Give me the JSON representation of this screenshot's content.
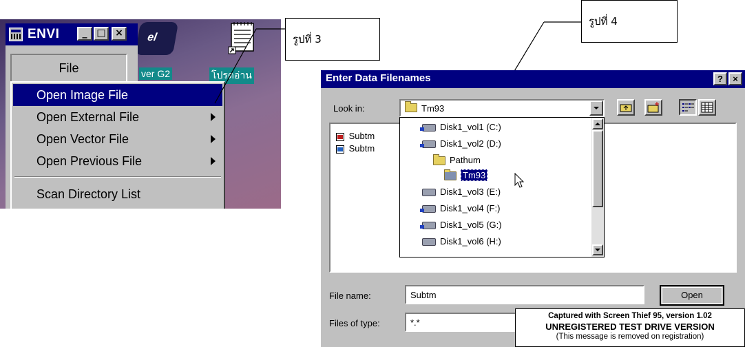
{
  "left_panel": {
    "window_title": "ENVI",
    "file_menu_label": "File",
    "menu_items": [
      {
        "label": "Open Image File",
        "selected": true,
        "submenu": false
      },
      {
        "label": "Open External File",
        "selected": false,
        "submenu": true
      },
      {
        "label": "Open Vector File",
        "selected": false,
        "submenu": true
      },
      {
        "label": "Open Previous File",
        "selected": false,
        "submenu": true
      },
      {
        "label": "Scan Directory List",
        "selected": false,
        "submenu": false
      }
    ],
    "desktop_labels": {
      "left": "ver G2",
      "right": "โปรดอ่าน",
      "logo": "el"
    },
    "callout": "รูปที่ 3"
  },
  "dialog": {
    "title": "Enter Data Filenames",
    "callout": "รูปที่ 4",
    "look_in_label": "Look in:",
    "look_in_value": "Tm93",
    "files": [
      "Subtm",
      "Subtm"
    ],
    "tree": [
      {
        "label": "Disk1_vol1 (C:)",
        "kind": "drive-net",
        "indent": 0
      },
      {
        "label": "Disk1_vol2 (D:)",
        "kind": "drive-net",
        "indent": 0
      },
      {
        "label": "Pathum",
        "kind": "folder",
        "indent": 1
      },
      {
        "label": "Tm93",
        "kind": "folder-open",
        "indent": 2,
        "selected": true
      },
      {
        "label": "Disk1_vol3 (E:)",
        "kind": "drive",
        "indent": 0
      },
      {
        "label": "Disk1_vol4 (F:)",
        "kind": "drive-net",
        "indent": 0
      },
      {
        "label": "Disk1_vol5 (G:)",
        "kind": "drive-net",
        "indent": 0
      },
      {
        "label": "Disk1_vol6 (H:)",
        "kind": "drive",
        "indent": 0
      }
    ],
    "file_name_label": "File name:",
    "file_name_value": "Subtm",
    "files_of_type_label": "Files of type:",
    "files_of_type_value": "*.*",
    "open_button": "Open",
    "help_button": "?",
    "close_button": "×"
  },
  "watermark": {
    "line1": "Captured with Screen Thief 95, version 1.02",
    "line2": "UNREGISTERED TEST DRIVE VERSION",
    "line3": "(This message is removed on registration)"
  }
}
